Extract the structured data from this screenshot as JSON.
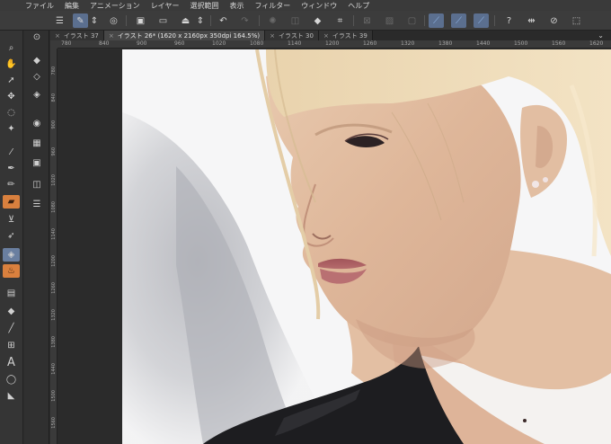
{
  "menu": {
    "logo": "஘",
    "items": [
      "ファイル",
      "編集",
      "アニメーション",
      "レイヤー",
      "選択範囲",
      "表示",
      "フィルター",
      "ウィンドウ",
      "ヘルプ"
    ]
  },
  "tabs": [
    {
      "label": "イラスト 37",
      "close": "×"
    },
    {
      "label": "イラスト 26* (1620 x 2160px 350dpi 164.5%)",
      "close": "×"
    },
    {
      "label": "イラスト 30",
      "close": "×"
    },
    {
      "label": "イラスト 39",
      "close": "×"
    }
  ],
  "tab_chevron": "⌄",
  "ruler": {
    "top": [
      "780",
      "840",
      "900",
      "960",
      "1020",
      "1080",
      "1140",
      "1200",
      "1260",
      "1320",
      "1380",
      "1440",
      "1500",
      "1560",
      "1620"
    ],
    "left": [
      "780",
      "840",
      "900",
      "960",
      "1020",
      "1080",
      "1140",
      "1200",
      "1260",
      "1320",
      "1380",
      "1440",
      "1500",
      "1560"
    ]
  },
  "colors": {
    "main_color": "#a98a83",
    "sub_color": "#e8d0c4",
    "active_tool": "#6a7fa0",
    "accent_tool": "#d9803e"
  },
  "tool_text": "A",
  "icons": {
    "commandbar": [
      "menu-icon",
      "brush-settings-icon",
      "clip-studio-icon",
      "new-canvas-icon",
      "open-file-icon",
      "save-icon",
      "upload-icon",
      "undo-icon",
      "redo-icon",
      "transform-icon",
      "fill-icon",
      "crop-icon",
      "snap-ruler-icon",
      "snap-grid-icon",
      "snap-point-icon",
      "help-icon",
      "flip-horizontal-icon",
      "rotate-icon"
    ],
    "tools": [
      "zoom-icon",
      "hand-icon",
      "move-icon",
      "lasso-icon",
      "magic-wand-icon",
      "pen-icon",
      "pencil-icon",
      "brush-icon",
      "airbrush-icon",
      "eraser-icon",
      "blend-icon",
      "fill-icon",
      "gradient-icon",
      "shape-icon",
      "line-icon",
      "frame-icon",
      "text-icon",
      "speech-balloon-icon",
      "ruler-icon"
    ]
  }
}
